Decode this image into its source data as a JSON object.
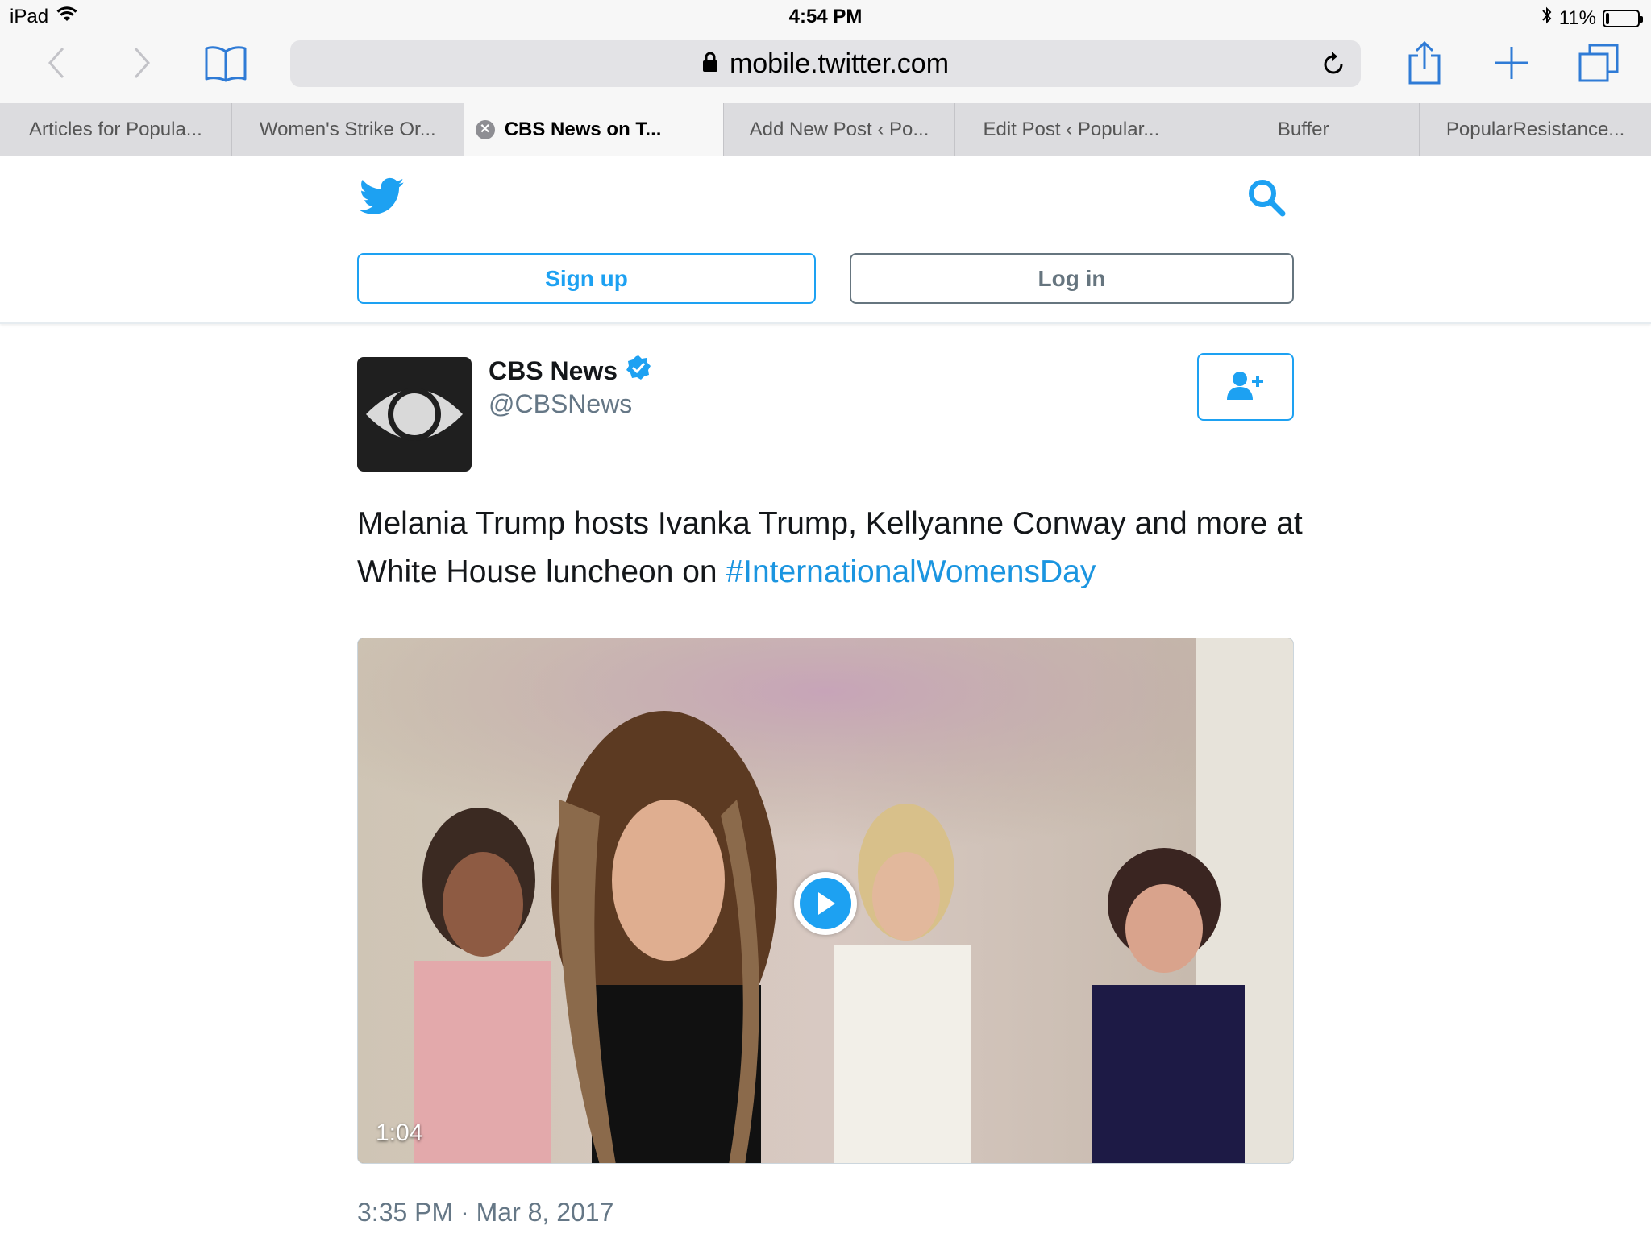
{
  "status_bar": {
    "device": "iPad",
    "time": "4:54 PM",
    "battery": "11%",
    "battery_level": 0.11
  },
  "toolbar": {
    "url": "mobile.twitter.com",
    "icons": [
      "back-icon",
      "forward-icon",
      "bookmarks-icon",
      "lock-icon",
      "reload-icon",
      "share-icon",
      "new-tab-icon",
      "tabs-icon"
    ]
  },
  "tabs": [
    {
      "label": "Articles for Popula..."
    },
    {
      "label": "Women's Strike Or..."
    },
    {
      "label": "CBS News on T..."
    },
    {
      "label": "Add New Post ‹ Po..."
    },
    {
      "label": "Edit Post ‹ Popular..."
    },
    {
      "label": "Buffer"
    },
    {
      "label": "PopularResistance..."
    }
  ],
  "header": {
    "signup_label": "Sign up",
    "login_label": "Log in"
  },
  "tweet": {
    "author_name": "CBS News",
    "author_handle": "@CBSNews",
    "text_before": "Melania Trump hosts Ivanka Trump, Kellyanne Conway and more at White House luncheon on ",
    "hashtag": "#InternationalWomensDay",
    "video_duration": "1:04",
    "timestamp": "3:35 PM · Mar 8, 2017"
  },
  "colors": {
    "twitter_blue": "#1da1f2",
    "hashtag_blue": "#1b95e0",
    "secondary_text": "#657786"
  }
}
